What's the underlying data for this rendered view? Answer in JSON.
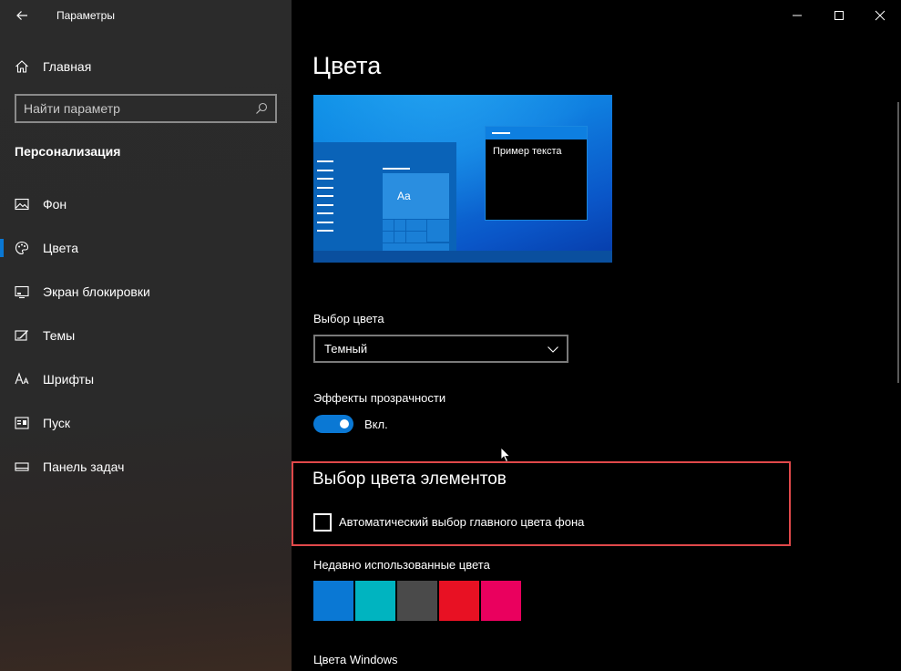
{
  "window": {
    "app_title": "Параметры",
    "controls": {
      "minimize": "minimize",
      "maximize": "maximize",
      "close": "close"
    }
  },
  "sidebar": {
    "home_label": "Главная",
    "search_placeholder": "Найти параметр",
    "section_title": "Персонализация",
    "items": [
      {
        "label": "Фон",
        "icon": "picture-icon",
        "selected": false
      },
      {
        "label": "Цвета",
        "icon": "palette-icon",
        "selected": true
      },
      {
        "label": "Экран блокировки",
        "icon": "lock-screen-icon",
        "selected": false
      },
      {
        "label": "Темы",
        "icon": "themes-icon",
        "selected": false
      },
      {
        "label": "Шрифты",
        "icon": "fonts-icon",
        "selected": false
      },
      {
        "label": "Пуск",
        "icon": "start-icon",
        "selected": false
      },
      {
        "label": "Панель задач",
        "icon": "taskbar-icon",
        "selected": false
      }
    ]
  },
  "main": {
    "title": "Цвета",
    "preview": {
      "sample_text": "Пример текста",
      "tile_text": "Aa"
    },
    "color_mode": {
      "label": "Выбор цвета",
      "value": "Темный"
    },
    "transparency": {
      "label": "Эффекты прозрачности",
      "state": "Вкл.",
      "on": true
    },
    "accent_section": {
      "title": "Выбор цвета элементов",
      "auto_label": "Автоматический выбор главного цвета фона",
      "auto_checked": false
    },
    "recent_colors": {
      "label": "Недавно использованные цвета",
      "colors": [
        "#0a78d4",
        "#00b4c0",
        "#4a4a4a",
        "#e81123",
        "#ea005e"
      ]
    },
    "windows_colors_label": "Цвета Windows"
  },
  "colors": {
    "accent": "#0a78d4",
    "highlight_border": "#e0484a"
  }
}
